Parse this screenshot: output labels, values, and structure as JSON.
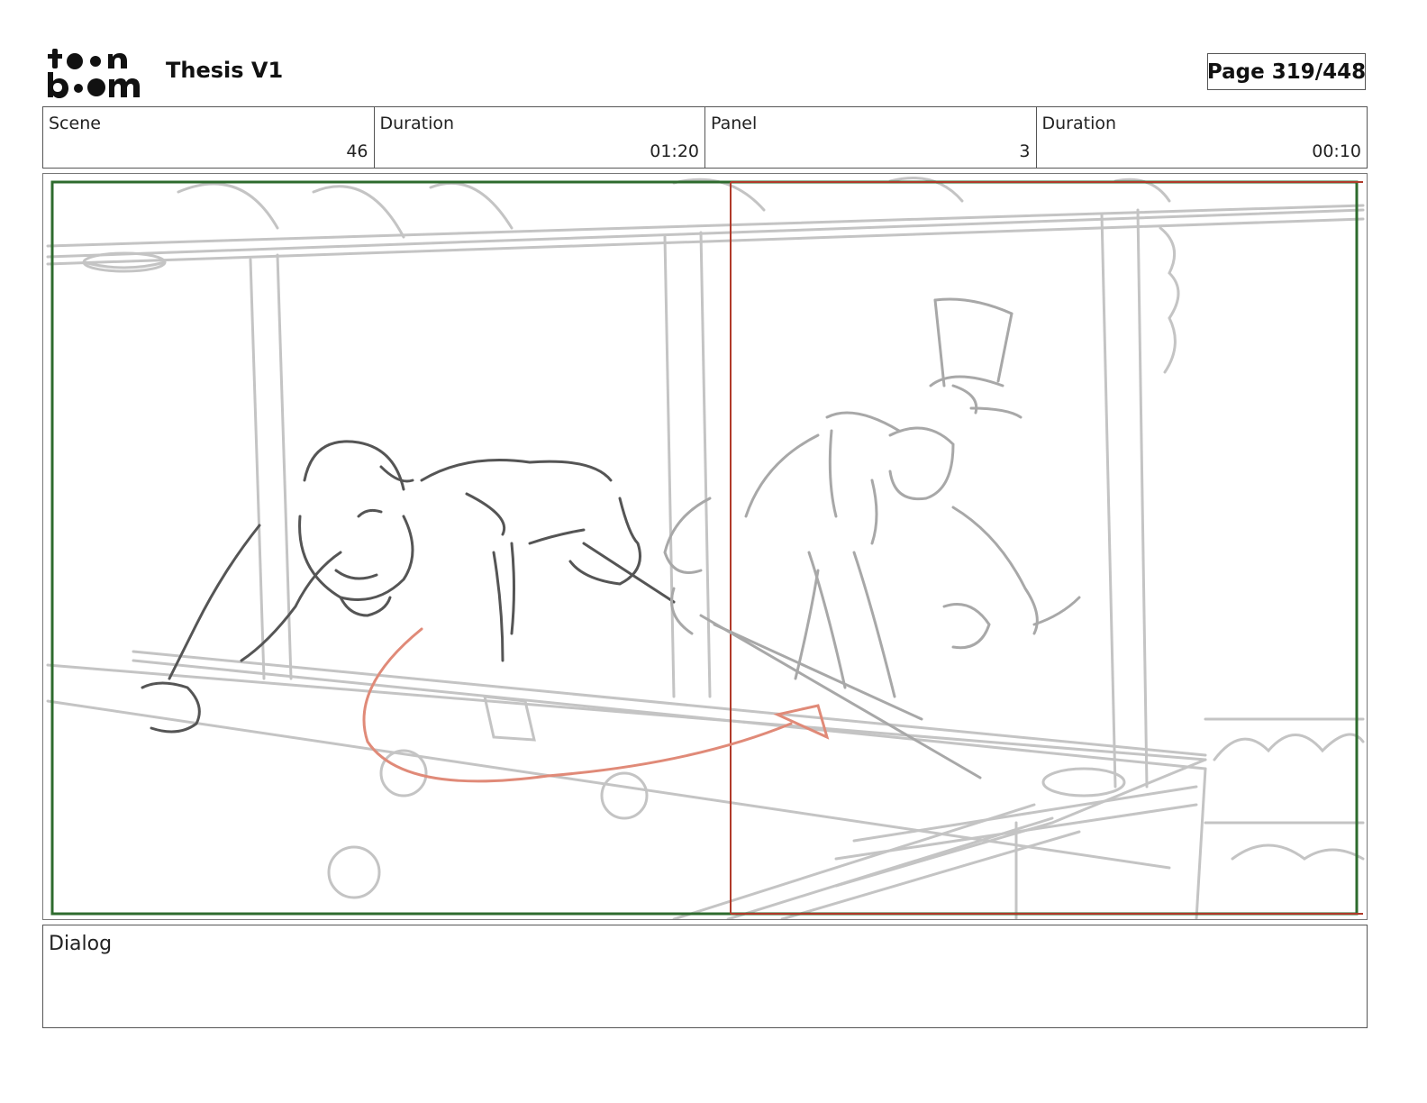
{
  "header": {
    "logo_text": "toonboom",
    "title": "Thesis V1",
    "page": "Page 319/448"
  },
  "info": {
    "scene_label": "Scene",
    "scene_value": "46",
    "scene_duration_label": "Duration",
    "scene_duration_value": "01:20",
    "panel_label": "Panel",
    "panel_value": "3",
    "panel_duration_label": "Duration",
    "panel_duration_value": "00:10"
  },
  "dialog": {
    "label": "Dialog",
    "text": ""
  },
  "colors": {
    "camera_frame": "#2e6b2e",
    "camera_move_line": "#b03a2a",
    "motion_arrow": "#e08a78",
    "sketch_dark": "#555555",
    "sketch_light": "#bdbdbd"
  }
}
